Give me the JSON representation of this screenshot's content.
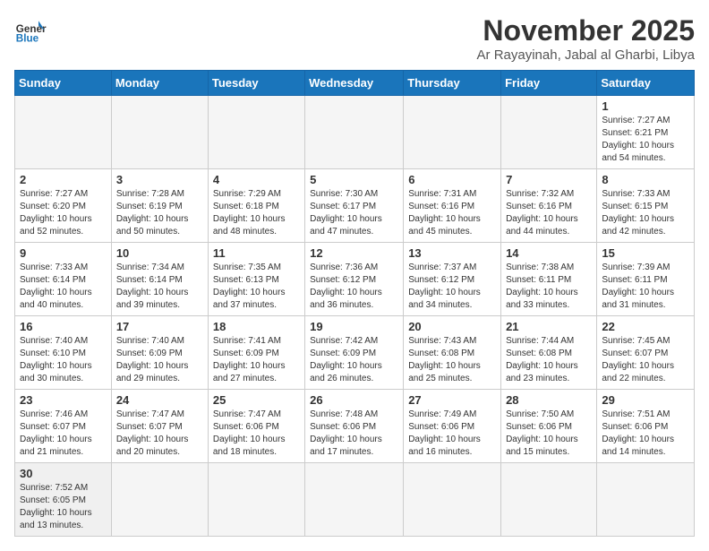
{
  "logo": {
    "general": "General",
    "blue": "Blue"
  },
  "header": {
    "month": "November 2025",
    "location": "Ar Rayayinah, Jabal al Gharbi, Libya"
  },
  "weekdays": [
    "Sunday",
    "Monday",
    "Tuesday",
    "Wednesday",
    "Thursday",
    "Friday",
    "Saturday"
  ],
  "days": [
    {
      "num": "",
      "info": ""
    },
    {
      "num": "",
      "info": ""
    },
    {
      "num": "",
      "info": ""
    },
    {
      "num": "",
      "info": ""
    },
    {
      "num": "",
      "info": ""
    },
    {
      "num": "",
      "info": ""
    },
    {
      "num": "1",
      "info": "Sunrise: 7:27 AM\nSunset: 6:21 PM\nDaylight: 10 hours and 54 minutes."
    },
    {
      "num": "2",
      "info": "Sunrise: 7:27 AM\nSunset: 6:20 PM\nDaylight: 10 hours and 52 minutes."
    },
    {
      "num": "3",
      "info": "Sunrise: 7:28 AM\nSunset: 6:19 PM\nDaylight: 10 hours and 50 minutes."
    },
    {
      "num": "4",
      "info": "Sunrise: 7:29 AM\nSunset: 6:18 PM\nDaylight: 10 hours and 48 minutes."
    },
    {
      "num": "5",
      "info": "Sunrise: 7:30 AM\nSunset: 6:17 PM\nDaylight: 10 hours and 47 minutes."
    },
    {
      "num": "6",
      "info": "Sunrise: 7:31 AM\nSunset: 6:16 PM\nDaylight: 10 hours and 45 minutes."
    },
    {
      "num": "7",
      "info": "Sunrise: 7:32 AM\nSunset: 6:16 PM\nDaylight: 10 hours and 44 minutes."
    },
    {
      "num": "8",
      "info": "Sunrise: 7:33 AM\nSunset: 6:15 PM\nDaylight: 10 hours and 42 minutes."
    },
    {
      "num": "9",
      "info": "Sunrise: 7:33 AM\nSunset: 6:14 PM\nDaylight: 10 hours and 40 minutes."
    },
    {
      "num": "10",
      "info": "Sunrise: 7:34 AM\nSunset: 6:14 PM\nDaylight: 10 hours and 39 minutes."
    },
    {
      "num": "11",
      "info": "Sunrise: 7:35 AM\nSunset: 6:13 PM\nDaylight: 10 hours and 37 minutes."
    },
    {
      "num": "12",
      "info": "Sunrise: 7:36 AM\nSunset: 6:12 PM\nDaylight: 10 hours and 36 minutes."
    },
    {
      "num": "13",
      "info": "Sunrise: 7:37 AM\nSunset: 6:12 PM\nDaylight: 10 hours and 34 minutes."
    },
    {
      "num": "14",
      "info": "Sunrise: 7:38 AM\nSunset: 6:11 PM\nDaylight: 10 hours and 33 minutes."
    },
    {
      "num": "15",
      "info": "Sunrise: 7:39 AM\nSunset: 6:11 PM\nDaylight: 10 hours and 31 minutes."
    },
    {
      "num": "16",
      "info": "Sunrise: 7:40 AM\nSunset: 6:10 PM\nDaylight: 10 hours and 30 minutes."
    },
    {
      "num": "17",
      "info": "Sunrise: 7:40 AM\nSunset: 6:09 PM\nDaylight: 10 hours and 29 minutes."
    },
    {
      "num": "18",
      "info": "Sunrise: 7:41 AM\nSunset: 6:09 PM\nDaylight: 10 hours and 27 minutes."
    },
    {
      "num": "19",
      "info": "Sunrise: 7:42 AM\nSunset: 6:09 PM\nDaylight: 10 hours and 26 minutes."
    },
    {
      "num": "20",
      "info": "Sunrise: 7:43 AM\nSunset: 6:08 PM\nDaylight: 10 hours and 25 minutes."
    },
    {
      "num": "21",
      "info": "Sunrise: 7:44 AM\nSunset: 6:08 PM\nDaylight: 10 hours and 23 minutes."
    },
    {
      "num": "22",
      "info": "Sunrise: 7:45 AM\nSunset: 6:07 PM\nDaylight: 10 hours and 22 minutes."
    },
    {
      "num": "23",
      "info": "Sunrise: 7:46 AM\nSunset: 6:07 PM\nDaylight: 10 hours and 21 minutes."
    },
    {
      "num": "24",
      "info": "Sunrise: 7:47 AM\nSunset: 6:07 PM\nDaylight: 10 hours and 20 minutes."
    },
    {
      "num": "25",
      "info": "Sunrise: 7:47 AM\nSunset: 6:06 PM\nDaylight: 10 hours and 18 minutes."
    },
    {
      "num": "26",
      "info": "Sunrise: 7:48 AM\nSunset: 6:06 PM\nDaylight: 10 hours and 17 minutes."
    },
    {
      "num": "27",
      "info": "Sunrise: 7:49 AM\nSunset: 6:06 PM\nDaylight: 10 hours and 16 minutes."
    },
    {
      "num": "28",
      "info": "Sunrise: 7:50 AM\nSunset: 6:06 PM\nDaylight: 10 hours and 15 minutes."
    },
    {
      "num": "29",
      "info": "Sunrise: 7:51 AM\nSunset: 6:06 PM\nDaylight: 10 hours and 14 minutes."
    },
    {
      "num": "30",
      "info": "Sunrise: 7:52 AM\nSunset: 6:05 PM\nDaylight: 10 hours and 13 minutes."
    }
  ]
}
